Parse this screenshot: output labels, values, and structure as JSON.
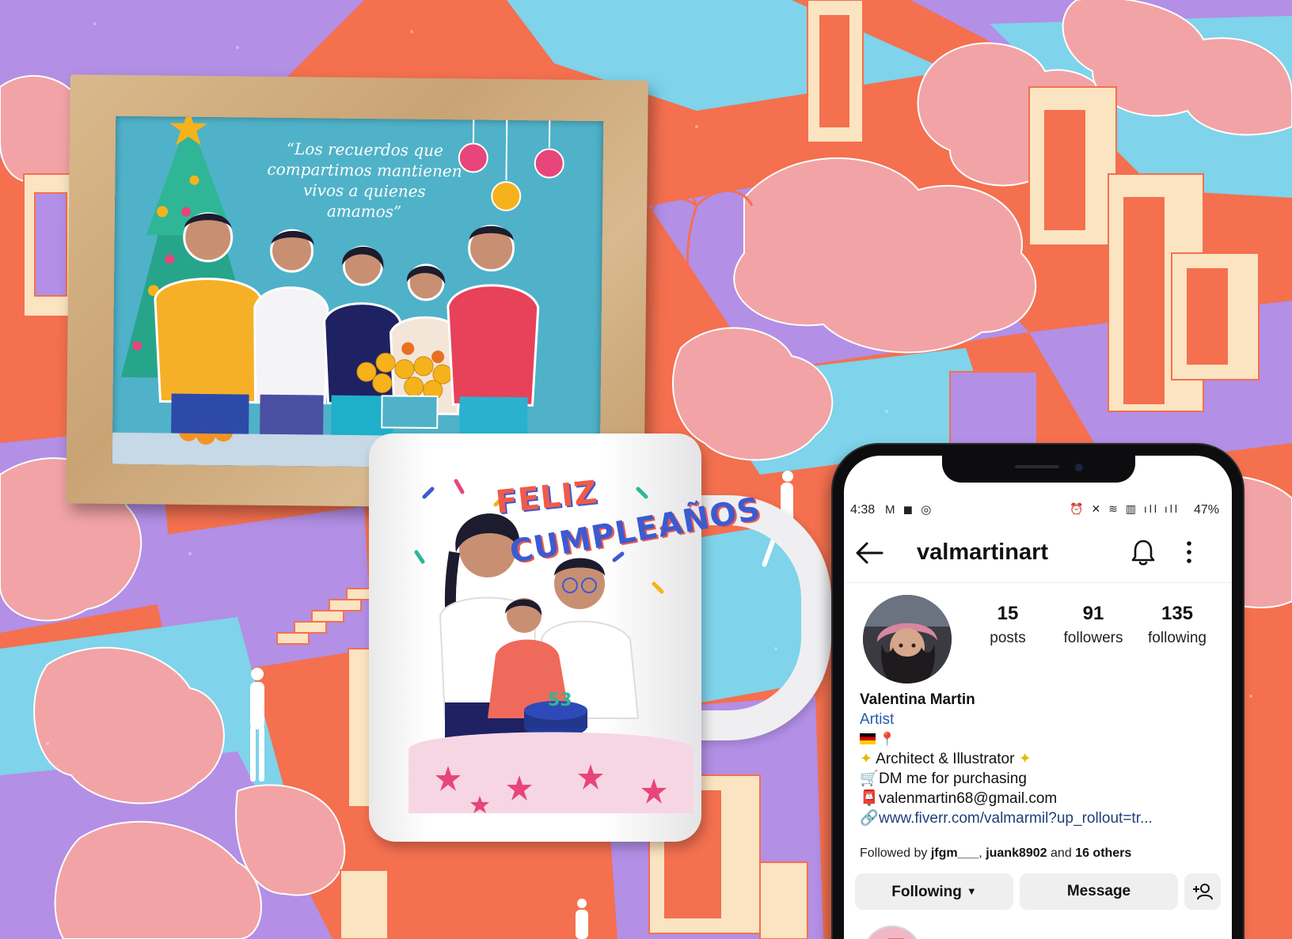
{
  "frame": {
    "quote_lines": [
      "“Los recuerdos que",
      "compartimos mantienen",
      "vivos a quienes",
      "amamos”"
    ]
  },
  "mug": {
    "title_line1": "FELIZ",
    "title_line2": "CUMPLEAÑOS",
    "cake_number": "53"
  },
  "phone": {
    "status": {
      "time": "4:38",
      "left_icons": "M ◼ ◎",
      "right_icons": "⏰ ✕ ≋ ▥ ıll ıll",
      "battery": "47%"
    },
    "profile": {
      "username": "valmartinart",
      "stats": [
        {
          "count": "15",
          "label": "posts"
        },
        {
          "count": "91",
          "label": "followers"
        },
        {
          "count": "135",
          "label": "following"
        }
      ],
      "name": "Valentina Martin",
      "category": "Artist",
      "bio_line_architect": "Architect & Illustrator",
      "bio_line_dm": "DM me for purchasing",
      "email": "valenmartin68@gmail.com",
      "website": "www.fiverr.com/valmarmil?up_rollout=tr...",
      "followed_by_prefix": "Followed by",
      "followed_by_user1": "jfgm___",
      "followed_by_user2": "juank8902",
      "followed_by_and": "and",
      "followed_by_others": "16 others",
      "following_button": "Following",
      "message_button": "Message"
    },
    "icons": {
      "back": "arrow-left-icon",
      "bell": "bell-icon",
      "menu": "more-vertical-icon",
      "add_user": "add-user-icon",
      "link": "link-icon"
    }
  },
  "colors": {
    "coral": "#f4704f",
    "pink": "#f2a3a6",
    "lavender": "#b38fe6",
    "sky": "#7fd3ea",
    "cream": "#fbe4c1",
    "link_blue": "#2659a8"
  }
}
